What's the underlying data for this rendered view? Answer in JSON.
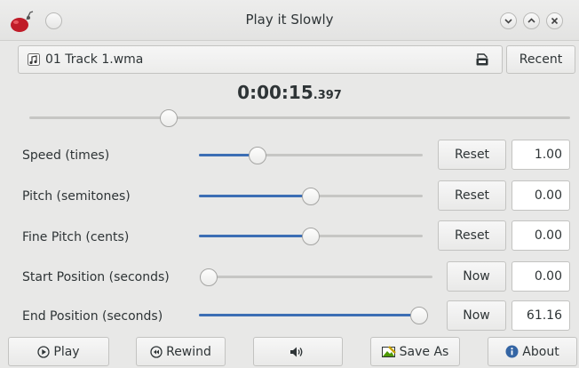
{
  "window": {
    "title": "Play it Slowly"
  },
  "file": {
    "name": "01 Track 1.wma",
    "recent_label": "Recent"
  },
  "time": {
    "main": "0:00:15",
    "fraction": ".397"
  },
  "position_slider": {
    "value_fraction": 0.25
  },
  "controls": [
    {
      "label": "Speed (times)",
      "button": "Reset",
      "value": "1.00",
      "fraction": 0.24
    },
    {
      "label": "Pitch (semitones)",
      "button": "Reset",
      "value": "0.00",
      "fraction": 0.5
    },
    {
      "label": "Fine Pitch (cents)",
      "button": "Reset",
      "value": "0.00",
      "fraction": 0.5
    },
    {
      "label": "Start Position (seconds)",
      "button": "Now",
      "value": "0.00",
      "fraction": 0.0
    },
    {
      "label": "End Position (seconds)",
      "button": "Now",
      "value": "61.16",
      "fraction": 1.0
    }
  ],
  "bottom": {
    "play": "Play",
    "rewind": "Rewind",
    "save_as": "Save As",
    "about": "About"
  },
  "colors": {
    "accent": "#3c6eb4",
    "app_icon": "#c01c28",
    "about_icon": "#3465a4"
  }
}
